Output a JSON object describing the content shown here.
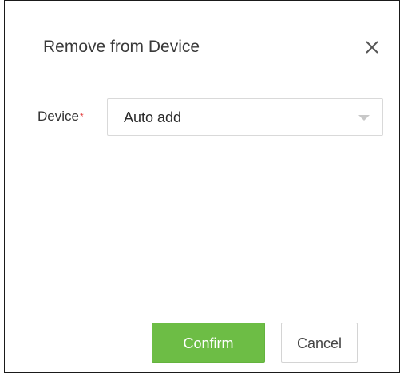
{
  "dialog": {
    "title": "Remove from Device",
    "close_icon": "close-icon"
  },
  "form": {
    "device_label": "Device",
    "required_mark": "*",
    "device_value": "Auto add",
    "dropdown_icon": "chevron-down-icon"
  },
  "buttons": {
    "confirm_label": "Confirm",
    "cancel_label": "Cancel"
  },
  "colors": {
    "confirm_button": "#6dbd45",
    "required_mark": "#e33d3d",
    "dialog_border": "#1a1a1a"
  }
}
